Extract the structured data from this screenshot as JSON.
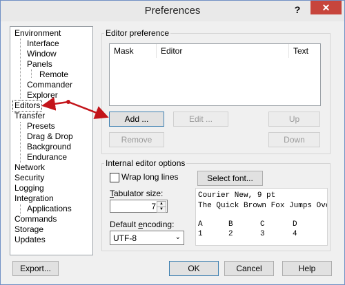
{
  "window": {
    "title": "Preferences",
    "help": "?",
    "close": "✕"
  },
  "tree": {
    "items": [
      {
        "label": "Environment"
      },
      {
        "label": "Interface"
      },
      {
        "label": "Window"
      },
      {
        "label": "Panels"
      },
      {
        "label": "Remote"
      },
      {
        "label": "Commander"
      },
      {
        "label": "Explorer"
      },
      {
        "label": "Editors"
      },
      {
        "label": "Transfer"
      },
      {
        "label": "Presets"
      },
      {
        "label": "Drag & Drop"
      },
      {
        "label": "Background"
      },
      {
        "label": "Endurance"
      },
      {
        "label": "Network"
      },
      {
        "label": "Security"
      },
      {
        "label": "Logging"
      },
      {
        "label": "Integration"
      },
      {
        "label": "Applications"
      },
      {
        "label": "Commands"
      },
      {
        "label": "Storage"
      },
      {
        "label": "Updates"
      }
    ]
  },
  "editor_preference": {
    "group_label": "Editor preference",
    "columns": [
      "Mask",
      "Editor",
      "Text"
    ],
    "buttons": {
      "add": "Add ...",
      "edit": "Edit ...",
      "up": "Up",
      "remove": "Remove",
      "down": "Down"
    }
  },
  "internal_options": {
    "group_label": "Internal editor options",
    "wrap_label": "Wrap long lines",
    "select_font": "Select font...",
    "tab_size_label_u": "T",
    "tab_size_label_rest": "abulator size:",
    "tab_size_value": "7",
    "encoding_label_pre": "Default ",
    "encoding_label_u": "e",
    "encoding_label_rest": "ncoding:",
    "encoding_value": "UTF-8",
    "preview": {
      "line1": "Courier New, 9 pt",
      "line2": "The Quick Brown Fox Jumps Over",
      "row_a": [
        "A",
        "B",
        "C",
        "D"
      ],
      "row_b": [
        "1",
        "2",
        "3",
        "4"
      ]
    }
  },
  "footer": {
    "export": "Export...",
    "ok": "OK",
    "cancel": "Cancel",
    "help": "Help"
  },
  "colors": {
    "arrow": "#c3141a",
    "close": "#c7453c"
  }
}
